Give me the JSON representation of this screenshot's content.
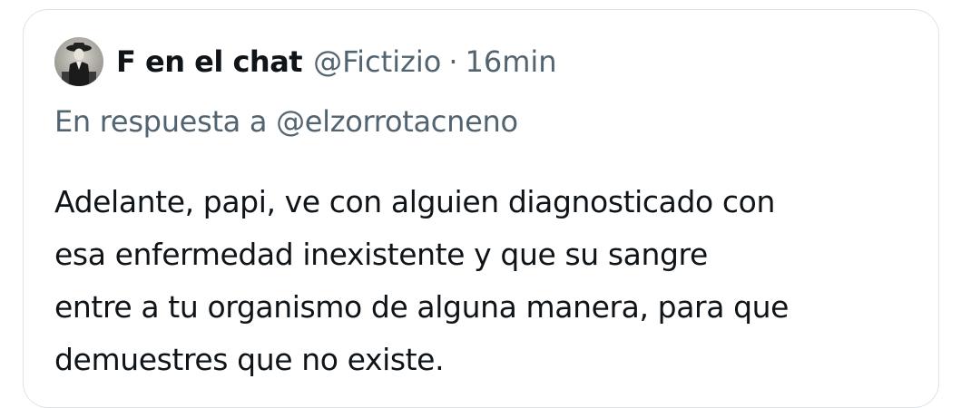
{
  "tweet": {
    "author_name": "F en el chat",
    "handle": "@Fictizio",
    "separator": "·",
    "time": "16min",
    "reply_prefix": "En respuesta a",
    "reply_to": "@elzorrotacneno",
    "text_lines": [
      "Adelante, papi, ve con alguien diagnosticado con",
      "esa enfermedad inexistente y que su sangre",
      "entre a tu organismo de alguna manera, para que",
      "demuestres que no existe."
    ]
  },
  "colors": {
    "text_primary": "#0f1419",
    "text_secondary": "#536471",
    "card_border": "#dfe3e7"
  }
}
